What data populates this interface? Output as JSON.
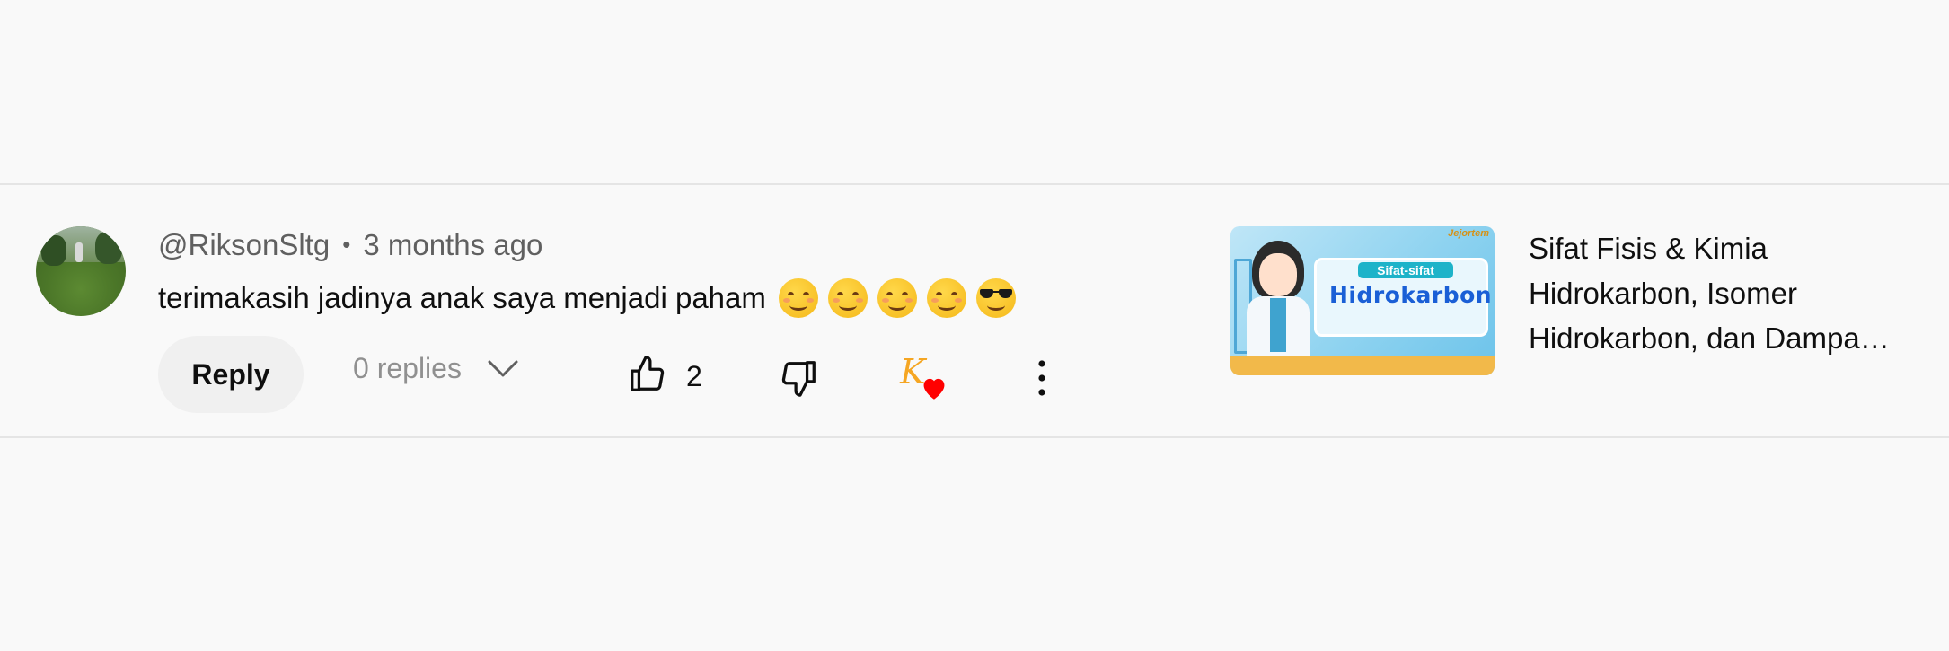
{
  "comment": {
    "author": "@RiksonSltg",
    "separator": "•",
    "time": "3 months ago",
    "text": "terimakasih jadinya anak saya menjadi paham",
    "emojis": [
      "smiling-face-icon",
      "smiling-face-icon",
      "smiling-face-icon",
      "smiling-face-icon",
      "sunglasses-face-icon"
    ]
  },
  "actions": {
    "reply_label": "Reply",
    "replies_label": "0 replies",
    "like_count": "2",
    "creator_initial": "K",
    "creator_heart_color": "#ff0000"
  },
  "video": {
    "thumbnail_tag": "Sifat-sifat",
    "thumbnail_title": "Hidrokarbon",
    "thumbnail_brand": "Jejortem",
    "title_lines": [
      "Sifat Fisis & Kimia",
      "Hidrokarbon, Isomer",
      "Hidrokarbon, dan Dampa…"
    ]
  },
  "colors": {
    "background": "#f9f9f9",
    "secondary_text": "#606060",
    "muted_text": "#909090",
    "reply_bg": "#f0f0f0"
  }
}
